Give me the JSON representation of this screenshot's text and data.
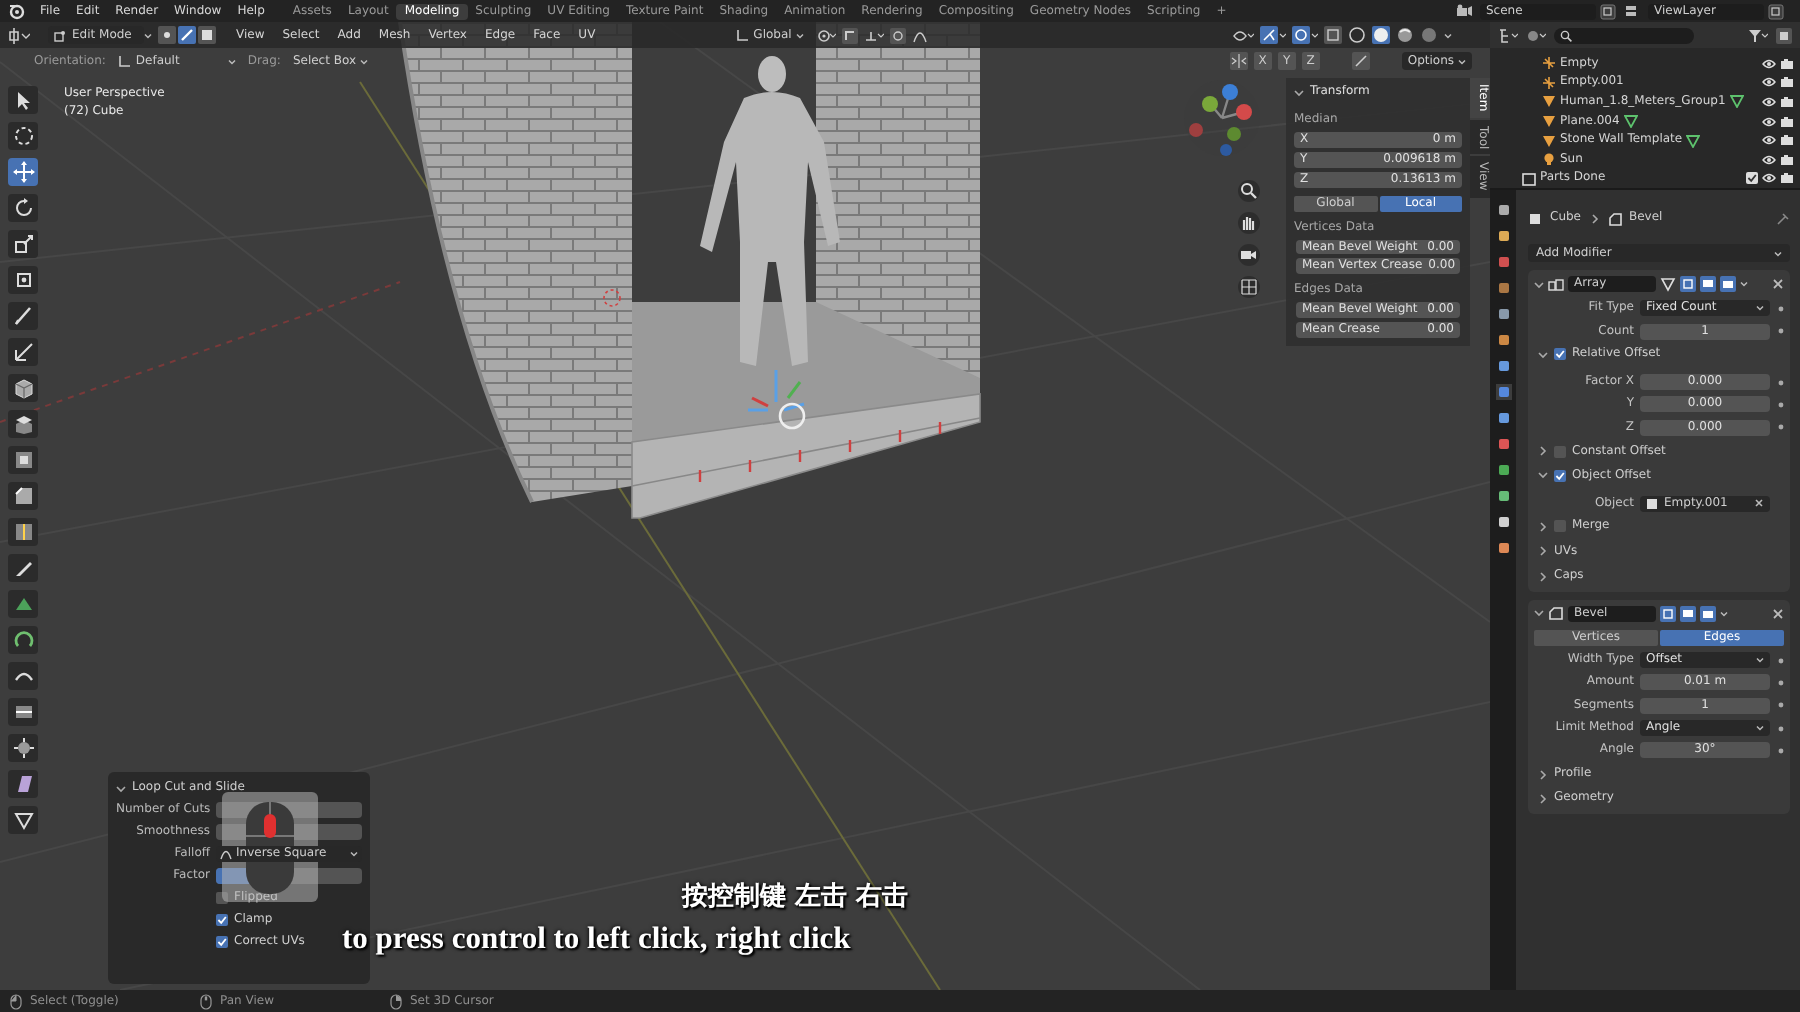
{
  "menu": [
    "File",
    "Edit",
    "Render",
    "Window",
    "Help"
  ],
  "workspaces": [
    {
      "label": "Assets",
      "selected": false
    },
    {
      "label": "Layout",
      "selected": false
    },
    {
      "label": "Modeling",
      "selected": true
    },
    {
      "label": "Sculpting",
      "selected": false
    },
    {
      "label": "UV Editing",
      "selected": false
    },
    {
      "label": "Texture Paint",
      "selected": false
    },
    {
      "label": "Shading",
      "selected": false
    },
    {
      "label": "Animation",
      "selected": false
    },
    {
      "label": "Rendering",
      "selected": false
    },
    {
      "label": "Compositing",
      "selected": false
    },
    {
      "label": "Geometry Nodes",
      "selected": false
    },
    {
      "label": "Scripting",
      "selected": false
    }
  ],
  "add_workspace": "+",
  "scene": "Scene",
  "view_layer": "ViewLayer",
  "header": {
    "mode": "Edit Mode",
    "select_modes": [
      {
        "selected": false
      },
      {
        "selected": true
      },
      {
        "selected": false
      }
    ],
    "menus": [
      "View",
      "Select",
      "Add",
      "Mesh",
      "Vertex",
      "Edge",
      "Face",
      "UV"
    ],
    "transform_orientation": "Global",
    "axes": [
      "X",
      "Y",
      "Z"
    ],
    "options": "Options"
  },
  "tool_settings": {
    "orientation_label": "Orientation:",
    "orientation": "Default",
    "drag_label": "Drag:",
    "drag": "Select Box"
  },
  "viewport": {
    "view_name": "User Perspective",
    "object": "(72) Cube"
  },
  "sidebar": {
    "tabs": [
      {
        "label": "Item",
        "selected": true
      },
      {
        "label": "Tool",
        "selected": false
      },
      {
        "label": "View",
        "selected": false
      }
    ],
    "title": "Transform",
    "median_label": "Median",
    "fields": [
      {
        "label": "X",
        "value": "0 m"
      },
      {
        "label": "Y",
        "value": "0.009618 m"
      },
      {
        "label": "Z",
        "value": "0.13613 m"
      }
    ],
    "spaces": [
      {
        "label": "Global",
        "selected": false
      },
      {
        "label": "Local",
        "selected": true
      }
    ],
    "sections": [
      {
        "title": "Vertices Data",
        "fields": [
          {
            "label": "Mean Bevel Weight",
            "value": "0.00"
          },
          {
            "label": "Mean Vertex Crease",
            "value": "0.00"
          }
        ]
      },
      {
        "title": "Edges Data",
        "fields": [
          {
            "label": "Mean Bevel Weight",
            "value": "0.00"
          },
          {
            "label": "Mean Crease",
            "value": "0.00"
          }
        ]
      }
    ]
  },
  "outliner": {
    "items": [
      {
        "name": "Empty",
        "kind": "empty"
      },
      {
        "name": "Empty.001",
        "kind": "empty"
      },
      {
        "name": "Human_1.8_Meters_Group1",
        "kind": "mesh"
      },
      {
        "name": "Plane.004",
        "kind": "mesh"
      },
      {
        "name": "Stone Wall Template",
        "kind": "mesh"
      },
      {
        "name": "Sun",
        "kind": "light"
      },
      {
        "name": "Parts Done",
        "kind": "collection"
      }
    ]
  },
  "properties": {
    "breadcrumb": [
      "Cube",
      "Bevel"
    ],
    "add_modifier": "Add Modifier",
    "modifiers": [
      {
        "name": "Array",
        "kind": "array",
        "rows": [
          {
            "kind": "dropdown",
            "label": "Fit Type",
            "value": "Fixed Count"
          },
          {
            "kind": "number",
            "label": "Count",
            "value": "1"
          },
          {
            "kind": "subpanel",
            "label": "Relative Offset",
            "expanded": true,
            "checked": true
          },
          {
            "kind": "number",
            "label": "Factor X",
            "value": "0.000"
          },
          {
            "kind": "number",
            "label": "Y",
            "value": "0.000"
          },
          {
            "kind": "number",
            "label": "Z",
            "value": "0.000"
          },
          {
            "kind": "subpanel",
            "label": "Constant Offset",
            "expanded": false,
            "checked": false
          },
          {
            "kind": "subpanel",
            "label": "Object Offset",
            "expanded": true,
            "checked": true
          },
          {
            "kind": "object",
            "label": "Object",
            "value": "Empty.001"
          },
          {
            "kind": "subpanel",
            "label": "Merge",
            "expanded": false,
            "checked": false
          },
          {
            "kind": "section",
            "label": "UVs",
            "expanded": false
          },
          {
            "kind": "section",
            "label": "Caps",
            "expanded": false
          }
        ]
      },
      {
        "name": "Bevel",
        "kind": "bevel",
        "rows": [
          {
            "kind": "segmented",
            "options": [
              {
                "label": "Vertices",
                "selected": false
              },
              {
                "label": "Edges",
                "selected": true
              }
            ]
          },
          {
            "kind": "dropdown",
            "label": "Width Type",
            "value": "Offset"
          },
          {
            "kind": "number",
            "label": "Amount",
            "value": "0.01 m"
          },
          {
            "kind": "number",
            "label": "Segments",
            "value": "1"
          },
          {
            "kind": "dropdown",
            "label": "Limit Method",
            "value": "Angle"
          },
          {
            "kind": "number",
            "label": "Angle",
            "value": "30°"
          },
          {
            "kind": "section",
            "label": "Profile",
            "expanded": false
          },
          {
            "kind": "section",
            "label": "Geometry",
            "expanded": false
          }
        ]
      }
    ]
  },
  "operator": {
    "title": "Loop Cut and Slide",
    "rows": [
      {
        "kind": "number",
        "label": "Number of Cuts"
      },
      {
        "kind": "number",
        "label": "Smoothness"
      },
      {
        "kind": "dropdown",
        "label": "Falloff",
        "value": "Inverse Square"
      },
      {
        "kind": "slider",
        "label": "Factor",
        "level": 0.5
      },
      {
        "kind": "check",
        "label": "Flipped",
        "checked": false
      },
      {
        "kind": "check",
        "label": "Clamp",
        "checked": true
      },
      {
        "kind": "check",
        "label": "Correct UVs",
        "checked": true
      }
    ]
  },
  "subtitles": {
    "chinese": "按控制键 左击 右击",
    "english": "to press control to left click, right click"
  },
  "status_bar": [
    {
      "label": "Select (Toggle)"
    },
    {
      "label": "Pan View"
    },
    {
      "label": "Set 3D Cursor"
    }
  ]
}
